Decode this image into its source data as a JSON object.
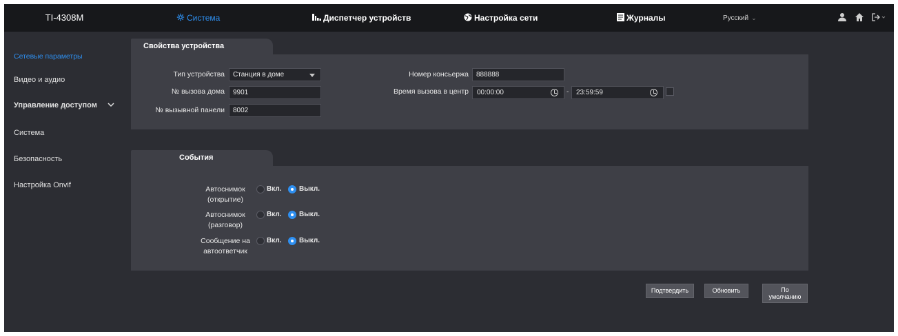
{
  "header": {
    "brand": "TI-4308M",
    "nav": [
      {
        "label": "Система",
        "icon": "gear-icon",
        "active": true
      },
      {
        "label": "Диспетчер устройств",
        "icon": "devices-icon",
        "active": false
      },
      {
        "label": "Настройка сети",
        "icon": "globe-icon",
        "active": false
      },
      {
        "label": "Журналы",
        "icon": "log-icon",
        "active": false
      }
    ],
    "language": "Русский",
    "icons": [
      "user-icon",
      "home-icon",
      "logout-icon"
    ]
  },
  "sidebar": {
    "items": [
      {
        "label": "Сетевые параметры",
        "active": true
      },
      {
        "label": "Видео и аудио",
        "active": false
      },
      {
        "label": "Управление доступом",
        "active": false,
        "expandable": true
      },
      {
        "label": "Система",
        "active": false
      },
      {
        "label": "Безопасность",
        "active": false
      },
      {
        "label": "Настройка Onvif",
        "active": false
      }
    ]
  },
  "device_props": {
    "tab": "Свойства устройства",
    "device_type_label": "Тип устройства",
    "device_type_value": "Станция в доме",
    "house_call_label": "№ вызова дома",
    "house_call_value": "9901",
    "panel_call_label": "№ вызывной панели",
    "panel_call_value": "8002",
    "concierge_label": "Номер консьержа",
    "concierge_value": "888888",
    "center_time_label": "Время вызова в центр",
    "time_start": "00:00:00",
    "time_sep": "-",
    "time_end": "23:59:59"
  },
  "events": {
    "tab": "События",
    "rows": [
      {
        "label_line1": "Автоснимок",
        "label_line2": "(открытие)",
        "on": "Вкл.",
        "off": "Выкл.",
        "selected": "off"
      },
      {
        "label_line1": "Автоснимок",
        "label_line2": "(разговор)",
        "on": "Вкл.",
        "off": "Выкл.",
        "selected": "off"
      },
      {
        "label_line1": "Сообщение на",
        "label_line2": "автоответчик",
        "on": "Вкл.",
        "off": "Выкл.",
        "selected": "off"
      }
    ]
  },
  "buttons": {
    "confirm": "Подтвердить",
    "refresh": "Обновить",
    "default_line1": "По",
    "default_line2": "умолчанию"
  },
  "colors": {
    "accent": "#2e8ff0",
    "topbar": "#17181b",
    "background": "#2c2d33",
    "panel": "#3e3f46"
  }
}
